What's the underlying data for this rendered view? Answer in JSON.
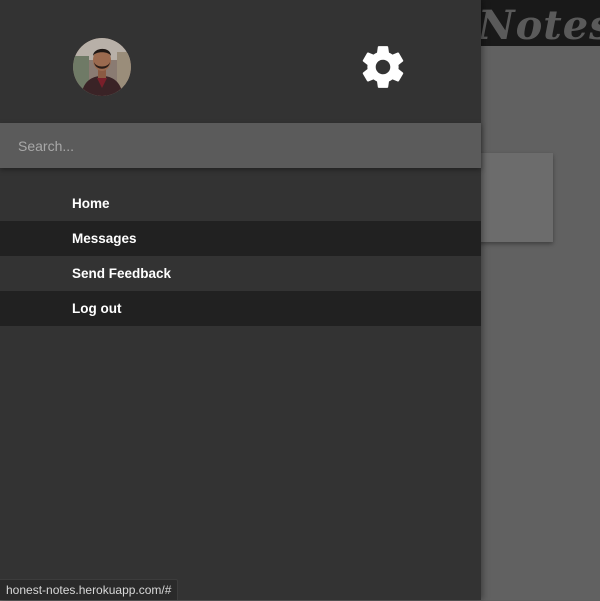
{
  "app": {
    "brand": "Notes"
  },
  "drawer": {
    "search": {
      "placeholder": "Search...",
      "value": ""
    },
    "menu": [
      {
        "label": "Home"
      },
      {
        "label": "Messages"
      },
      {
        "label": "Send Feedback"
      },
      {
        "label": "Log out"
      }
    ],
    "icons": {
      "settings": "gear-icon",
      "avatar": "user-avatar"
    }
  },
  "status_bar": {
    "url": "honest-notes.herokuapp.com/#"
  },
  "colors": {
    "drawer_bg": "#333333",
    "menu_alt_bg": "#212121",
    "search_bg": "#5b5b5b",
    "backdrop": "#616161",
    "header_bg": "#191919"
  }
}
